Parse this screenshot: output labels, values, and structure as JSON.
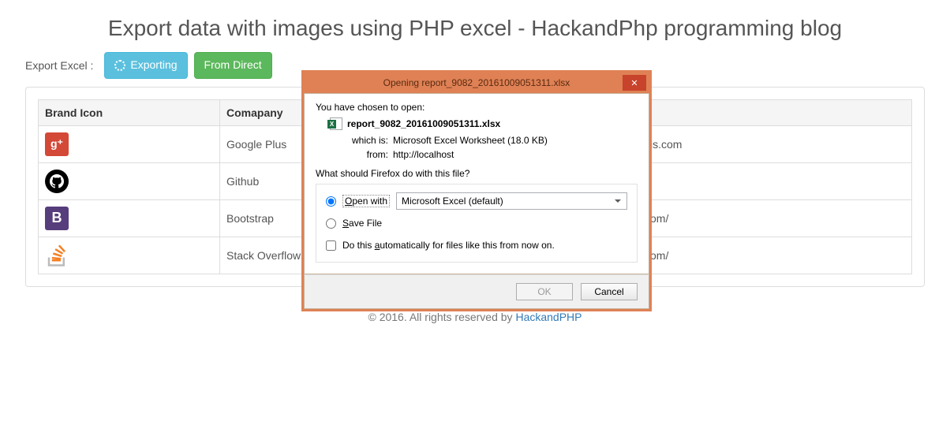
{
  "page": {
    "title": "Export data with images using PHP excel - HackandPhp programming blog"
  },
  "controls": {
    "label": "Export Excel :",
    "exporting_btn": "Exporting",
    "direct_btn": "From Direct"
  },
  "table": {
    "headers": {
      "icon": "Brand Icon",
      "company": "Comapany",
      "url": ""
    },
    "rows": [
      {
        "icon": "gplus",
        "company": "Google Plus",
        "url_tail": "is.com"
      },
      {
        "icon": "github",
        "company": "Github",
        "url_tail": ""
      },
      {
        "icon": "bootstrap",
        "company": "Bootstrap",
        "url_tail": "om/"
      },
      {
        "icon": "so",
        "company": "Stack Overflow",
        "url_tail": "om/"
      }
    ]
  },
  "footer": {
    "text": "© 2016. All rights reserved by ",
    "link": "HackandPHP"
  },
  "dialog": {
    "title": "Opening report_9082_20161009051311.xlsx",
    "prompt": "You have chosen to open:",
    "filename": "report_9082_20161009051311.xlsx",
    "which_is_label": "which is:",
    "which_is_value": "Microsoft Excel Worksheet (18.0 KB)",
    "from_label": "from:",
    "from_value": "http://localhost",
    "question": "What should Firefox do with this file?",
    "open_with_pre": "O",
    "open_with_post": "pen with",
    "open_with_app": "Microsoft Excel (default)",
    "save_file_pre": "S",
    "save_file_post": "ave File",
    "auto_pre": "Do this ",
    "auto_u": "a",
    "auto_post": "utomatically for files like this from now on.",
    "ok": "OK",
    "cancel": "Cancel"
  }
}
